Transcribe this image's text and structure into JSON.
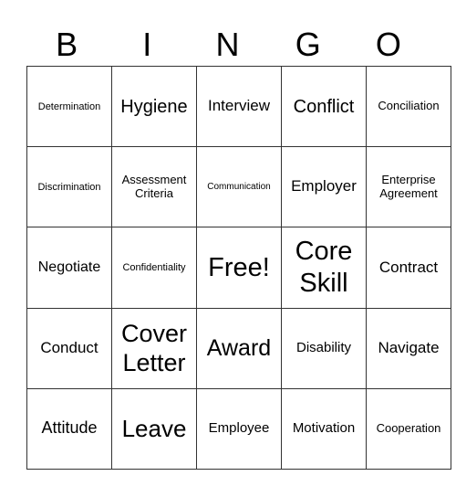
{
  "header": {
    "letters": [
      "B",
      "I",
      "N",
      "G",
      "O"
    ]
  },
  "card": {
    "rows": [
      [
        "Determination",
        "Hygiene",
        "Interview",
        "Conflict",
        "Conciliation"
      ],
      [
        "Discrimination",
        "Assessment Criteria",
        "Communication",
        "Employer",
        "Enterprise Agreement"
      ],
      [
        "Negotiate",
        "Confidentiality",
        "Free!",
        "Core Skill",
        "Contract"
      ],
      [
        "Conduct",
        "Cover Letter",
        "Award",
        "Disability",
        "Navigate"
      ],
      [
        "Attitude",
        "Leave",
        "Employee",
        "Motivation",
        "Cooperation"
      ]
    ]
  }
}
